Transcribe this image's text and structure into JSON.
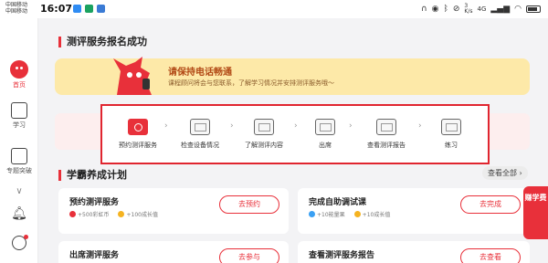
{
  "status_bar": {
    "carrier_1": "中国移动",
    "carrier_2": "中国移动",
    "time": "16:07",
    "net_speed": "3\nK/s",
    "signal": "4G"
  },
  "sidebar": {
    "items": [
      {
        "label": "首页",
        "icon": "mascot-home-icon",
        "active": true
      },
      {
        "label": "学习",
        "icon": "video-lesson-icon",
        "active": false
      },
      {
        "label": "专题突破",
        "icon": "topic-arrow-icon",
        "active": false
      }
    ],
    "bell_icon": "bell-icon",
    "more_icon": "chevron-down-icon",
    "user_icon": "user-icon"
  },
  "main": {
    "page_title": "测评服务报名成功",
    "banner": {
      "title": "请保持电话畅通",
      "subtitle": "课程顾问将会与您联系，了解学习情况并安排测评服务哦～"
    },
    "steps": [
      {
        "label": "预约测评服务",
        "icon": "calendar-icon",
        "active": true
      },
      {
        "label": "检查设备情况",
        "icon": "device-icon",
        "active": false
      },
      {
        "label": "了解测评内容",
        "icon": "document-icon",
        "active": false
      },
      {
        "label": "出席",
        "icon": "play-icon",
        "active": false
      },
      {
        "label": "查看测评报告",
        "icon": "report-chart-icon",
        "active": false
      },
      {
        "label": "练习",
        "icon": "practice-icon",
        "active": false
      }
    ],
    "plan_title": "学霸养成计划",
    "view_all": "查看全部 ›",
    "cards": [
      {
        "title": "预约测评服务",
        "reward_1": "+500彩虹币",
        "reward_2": "+100成长值",
        "button": "去预约"
      },
      {
        "title": "完成自助调试课",
        "reward_1": "+10能量果",
        "reward_2": "+10成长值",
        "button": "去完成"
      },
      {
        "title": "出席测评服务",
        "reward_1": "",
        "reward_2": "",
        "button": "去参与"
      },
      {
        "title": "查看测评服务报告",
        "reward_1": "",
        "reward_2": "",
        "button": "去查看"
      }
    ],
    "earn_badge": "赚学费"
  },
  "colors": {
    "accent": "#e8303a",
    "banner_bg": "#fde9a8",
    "highlight_border": "#e0252f"
  }
}
